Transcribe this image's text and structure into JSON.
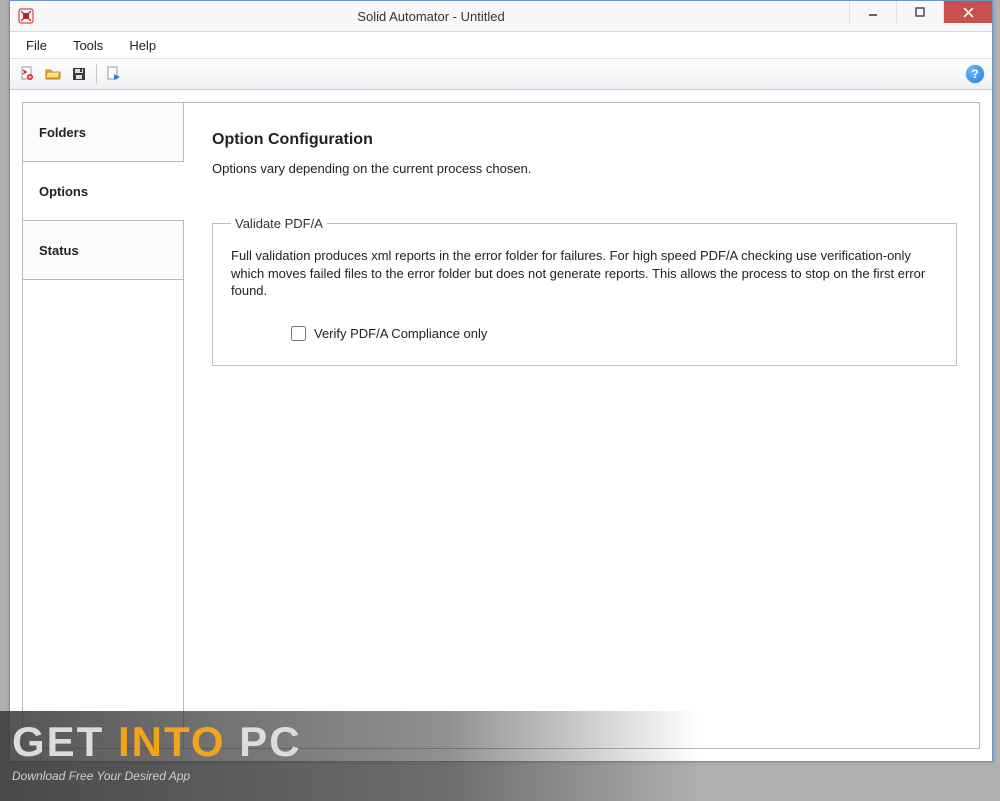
{
  "window": {
    "title": "Solid Automator - Untitled"
  },
  "menu": {
    "items": [
      "File",
      "Tools",
      "Help"
    ]
  },
  "toolbar": {
    "icons": [
      "new-doc-icon",
      "open-folder-icon",
      "save-icon",
      "run-icon"
    ],
    "help_tooltip": "?"
  },
  "sidebar": {
    "tabs": [
      {
        "label": "Folders",
        "active": false
      },
      {
        "label": "Options",
        "active": true
      },
      {
        "label": "Status",
        "active": false
      }
    ]
  },
  "content": {
    "heading": "Option Configuration",
    "subheading": "Options vary depending on the current process chosen.",
    "group": {
      "legend": "Validate PDF/A",
      "description": "Full validation produces xml reports in the error folder for failures.  For high speed PDF/A checking use verification-only which moves failed files to the error folder but does not generate reports. This allows the process to stop on the first error found.",
      "checkbox_label": "Verify PDF/A Compliance only",
      "checkbox_checked": false
    }
  },
  "watermark": {
    "w1": "GET ",
    "w2": "INTO ",
    "w3": "PC",
    "tag": "Download Free Your Desired App"
  }
}
